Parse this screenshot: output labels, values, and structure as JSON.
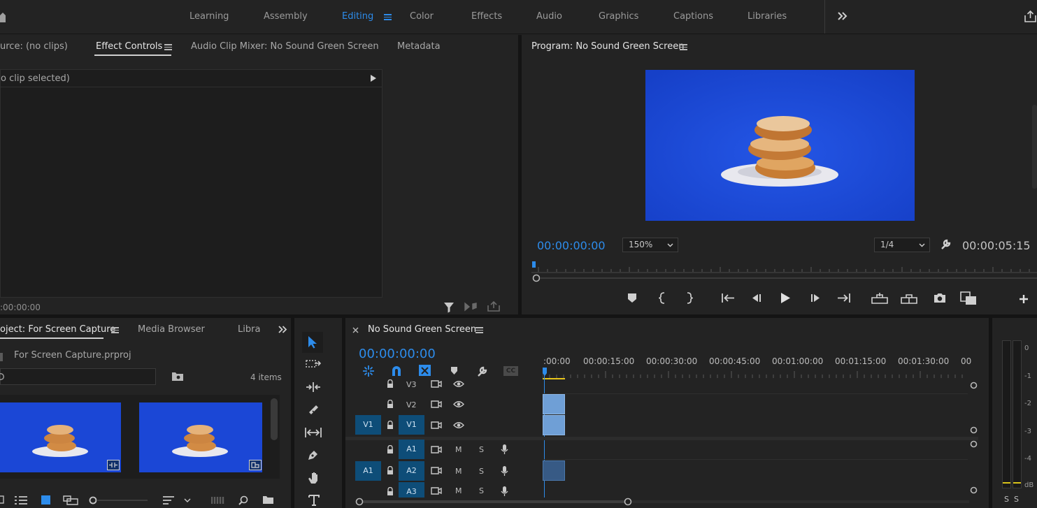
{
  "workspace": {
    "tabs": [
      {
        "label": "Learning"
      },
      {
        "label": "Assembly"
      },
      {
        "label": "Editing",
        "active": true
      },
      {
        "label": "Color"
      },
      {
        "label": "Effects"
      },
      {
        "label": "Audio"
      },
      {
        "label": "Graphics"
      },
      {
        "label": "Captions"
      },
      {
        "label": "Libraries"
      }
    ],
    "overflow_icon": "double-chevron-right-icon",
    "share_icon": "share-icon"
  },
  "source_panel": {
    "tabs": {
      "source": "urce: (no clips)",
      "effect_controls": "Effect Controls",
      "audio_mixer": "Audio Clip Mixer: No Sound Green Screen",
      "metadata": "Metadata"
    },
    "no_clip": "o clip selected)",
    "timecode": ":00:00:00"
  },
  "program_monitor": {
    "title": "Program: No Sound Green Screen",
    "timecode": "00:00:00:00",
    "zoom": "150%",
    "resolution": "1/4",
    "duration": "00:00:05:15",
    "video_bg": "#1b47d6"
  },
  "project_panel": {
    "tabs": {
      "project": "oject: For Screen Capture",
      "media_browser": "Media Browser",
      "libraries": "Libra"
    },
    "file": "For Screen Capture.prproj",
    "items_count": "4 items"
  },
  "timeline": {
    "sequence_name": "No Sound Green Screen",
    "timecode": "00:00:00:00",
    "ruler": [
      ":00:00",
      "00:00:15:00",
      "00:00:30:00",
      "00:00:45:00",
      "00:01:00:00",
      "00:01:15:00",
      "00:01:30:00",
      "00"
    ],
    "tracks": {
      "v3": "V3",
      "v2": "V2",
      "v1": "V1",
      "v1_src": "V1",
      "a1": "A1",
      "a1_src": "A1",
      "a2": "A2",
      "a3": "A3"
    },
    "mute": "M",
    "solo": "S",
    "cc": "CC"
  },
  "audio_meter": {
    "scale": [
      "0",
      "-1",
      "-2",
      "-3",
      "-4",
      "dB"
    ],
    "solo_left": "S",
    "solo_right": "S"
  }
}
